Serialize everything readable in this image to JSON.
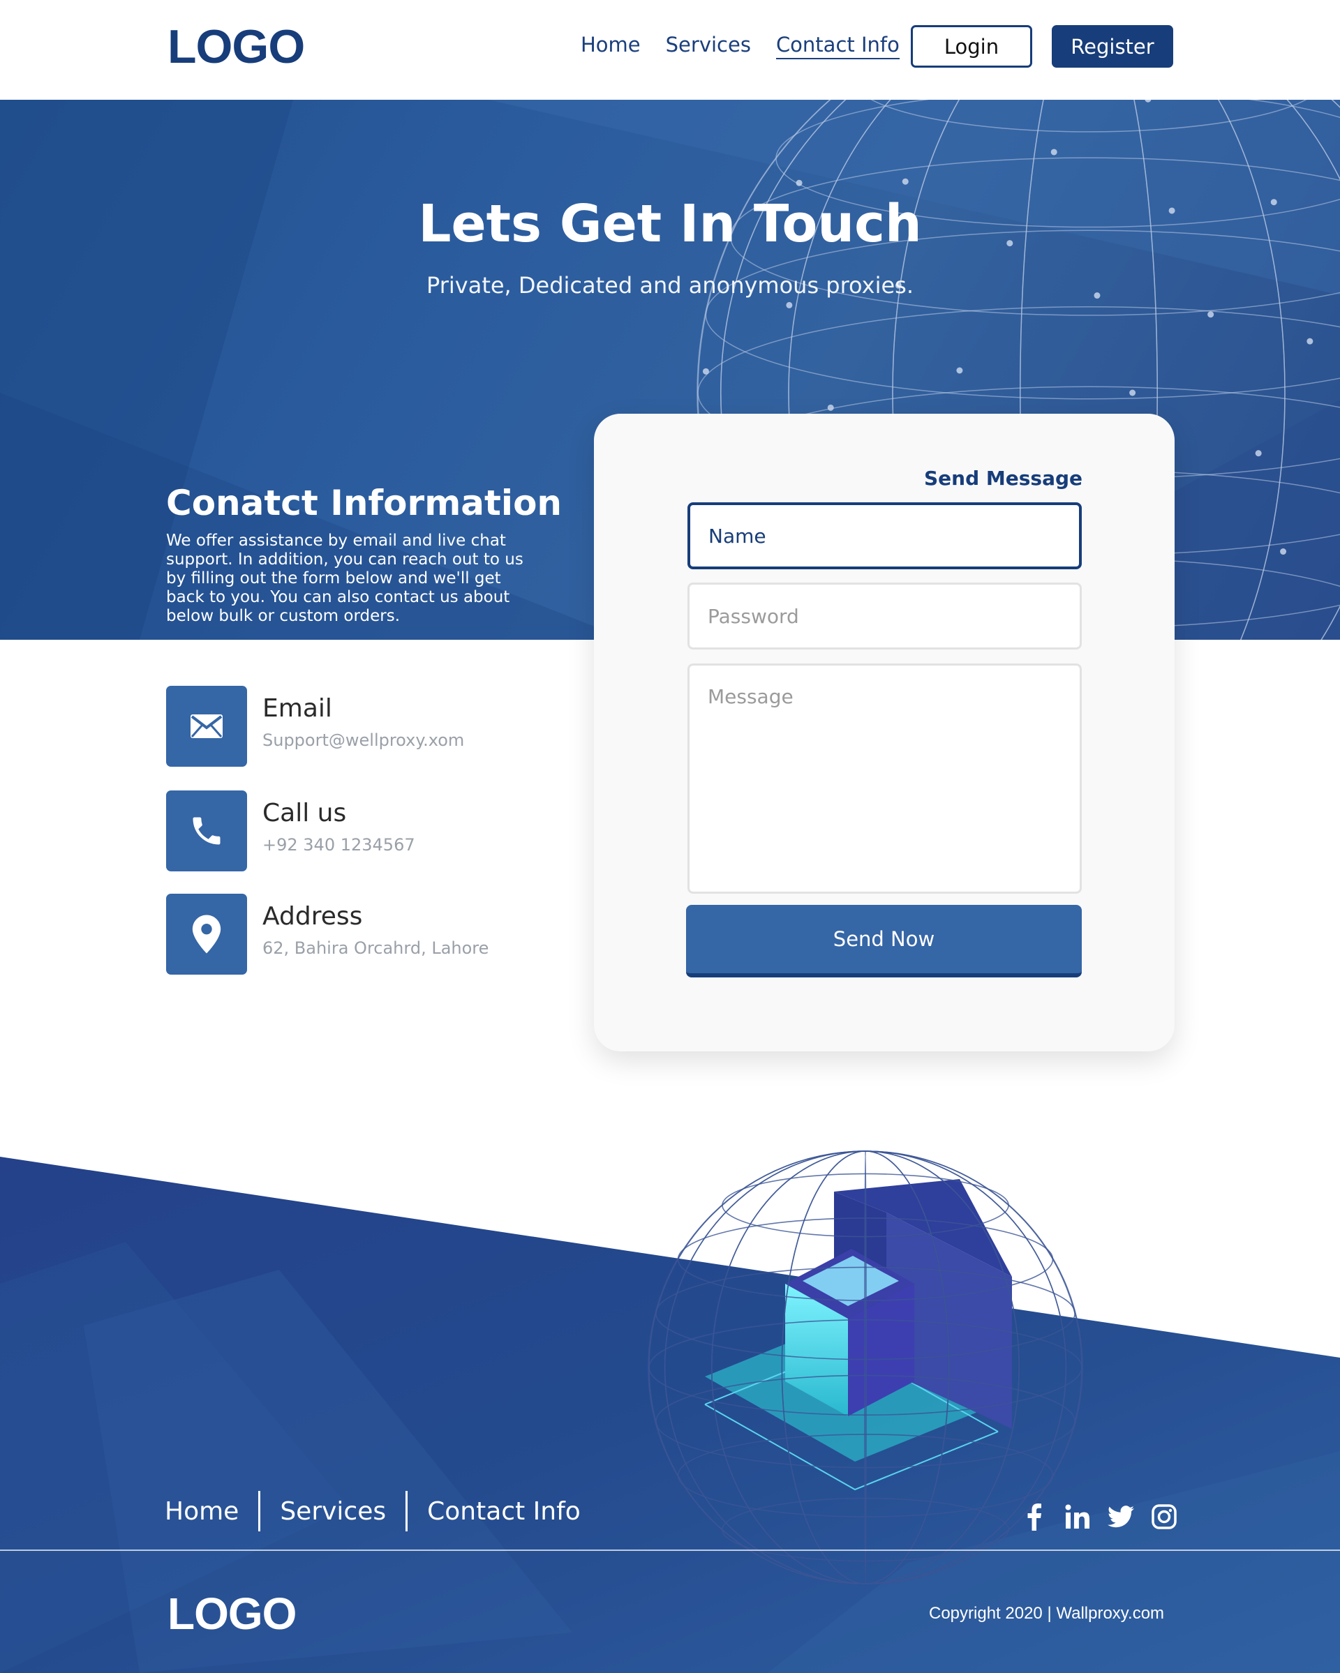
{
  "colors": {
    "brand_dark": "#173d7a",
    "brand": "#3566a6",
    "hero_bg": "#2b5c9e",
    "footer_bg": "#274f90",
    "text_muted": "#9aa0a8"
  },
  "header": {
    "logo": "LOGO",
    "nav": [
      "Home",
      "Services",
      "Contact Info"
    ],
    "active_nav": "Contact Info",
    "login_label": "Login",
    "register_label": "Register"
  },
  "hero": {
    "title": "Lets Get In Touch",
    "subtitle": "Private, Dedicated and anonymous proxies."
  },
  "contact_info": {
    "title": "Conatct Information",
    "description": "We offer assistance by email and live chat support. In addition, you can reach out to us by filling out the form below and we'll get back to you. You can also contact us about below bulk or custom orders.",
    "items": [
      {
        "icon": "envelope-icon",
        "label": "Email",
        "value": "Support@wellproxy.xom"
      },
      {
        "icon": "phone-icon",
        "label": "Call us",
        "value": "+92 340 1234567"
      },
      {
        "icon": "location-pin-icon",
        "label": "Address",
        "value": "62, Bahira Orcahrd, Lahore"
      }
    ]
  },
  "form": {
    "heading": "Send Message",
    "name_placeholder": "Name",
    "password_placeholder": "Password",
    "message_placeholder": "Message",
    "submit_label": "Send Now"
  },
  "footer": {
    "nav": [
      "Home",
      "Services",
      "Contact Info"
    ],
    "social": [
      "facebook-icon",
      "linkedin-icon",
      "twitter-icon",
      "instagram-icon"
    ],
    "logo": "LOGO",
    "copyright": "Copyright 2020 | Wallproxy.com"
  }
}
